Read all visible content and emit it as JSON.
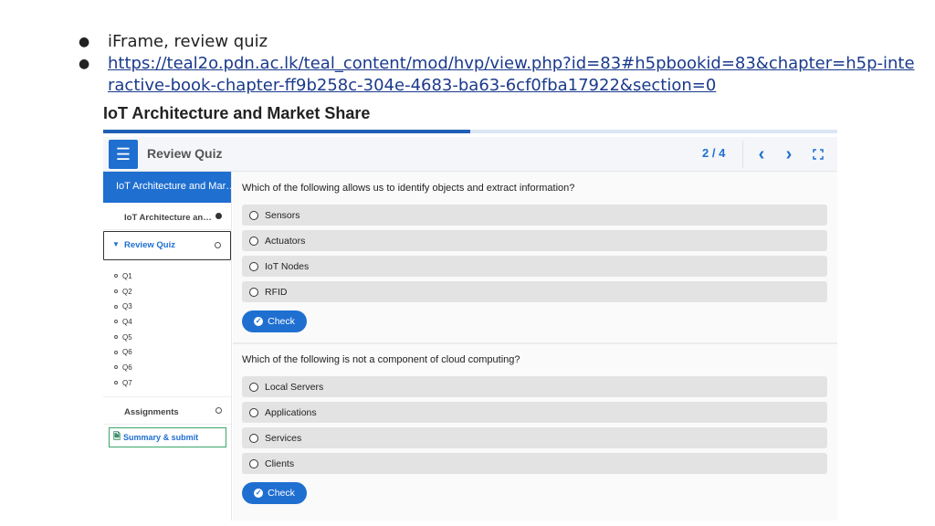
{
  "slide": {
    "bullets": [
      {
        "symbol": "●",
        "text": "iFrame, review quiz"
      },
      {
        "symbol": "●",
        "text": "https://teal2o.pdn.ac.lk/teal_content/mod/hvp/view.php?id=83#h5pbookid=83&chapter=h5p-interactive-book-chapter-ff9b258c-304e-4683-ba63-6cf0fba17922&section=0",
        "is_link": true
      }
    ]
  },
  "book": {
    "title": "IoT Architecture and Market Share",
    "progress_fraction": 0.5,
    "header": {
      "menu_icon": "hamburger-menu-icon",
      "title": "Review Quiz",
      "pager": "2 / 4",
      "prev_icon": "chevron-left-icon",
      "next_icon": "chevron-right-icon",
      "fullscreen_icon": "fullscreen-icon"
    },
    "sidebar": {
      "chapter": "IoT Architecture and Mar…",
      "sections": [
        {
          "label": "IoT Architecture an…",
          "status": "filled"
        },
        {
          "label": "Review Quiz",
          "status": "empty",
          "active": true
        }
      ],
      "questions": [
        "Q1",
        "Q2",
        "Q3",
        "Q4",
        "Q5",
        "Q6",
        "Q6",
        "Q7"
      ],
      "assignments": "Assignments",
      "summary_button": "Summary & submit"
    },
    "quiz": [
      {
        "question": "Which of the following allows us to identify objects and extract information?",
        "options": [
          "Sensors",
          "Actuators",
          "IoT Nodes",
          "RFID"
        ],
        "check_label": "Check"
      },
      {
        "question": "Which of the following is not a component of cloud computing?",
        "options": [
          "Local Servers",
          "Applications",
          "Services",
          "Clients"
        ],
        "check_label": "Check"
      }
    ],
    "colors": {
      "accent": "#1f6fd1",
      "progress": "#1f5fb5"
    }
  }
}
